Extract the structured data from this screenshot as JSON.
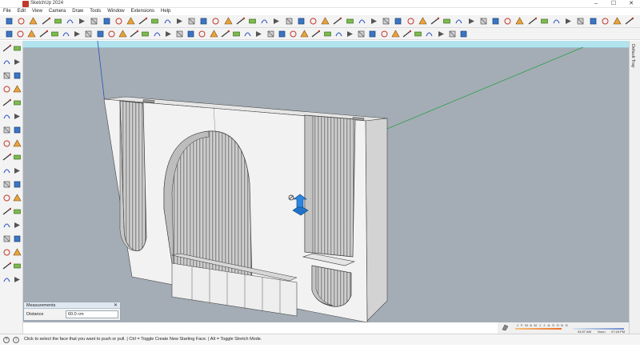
{
  "window": {
    "title": "SketchUp 2024",
    "controls": [
      "–",
      "☐",
      "✕"
    ]
  },
  "menu": [
    "File",
    "Edit",
    "View",
    "Camera",
    "Draw",
    "Tools",
    "Window",
    "Extensions",
    "Help"
  ],
  "colors": {
    "viewport_background": "#a4adb5",
    "sky": "#b3e3ee",
    "model_face": "#f2f2f2",
    "model_shadow_face": "#d6d6d6",
    "red_axis": "#c0392b",
    "green_axis": "#2e9e4a",
    "blue_axis": "#2b4fc0",
    "push_pull_cursor": "#1f73c9"
  },
  "toolbar_top_icons": [
    "orbit-icon",
    "pan-icon",
    "zoom-icon",
    "zoom-extents-icon",
    "iso-view-icon",
    "top-view-icon",
    "front-view-icon",
    "right-view-icon",
    "back-view-icon",
    "left-view-icon",
    "bottom-view-icon",
    "xray-icon",
    "wireframe-icon",
    "hidden-line-icon",
    "shaded-icon",
    "shaded-textures-icon",
    "monochrome-icon",
    "move-icon",
    "push-pull-icon",
    "rotate-icon",
    "follow-me-icon",
    "scale-icon",
    "offset-icon",
    "tape-measure-icon",
    "dimension-icon",
    "protractor-icon",
    "text-icon",
    "axes-icon",
    "3d-text-icon",
    "section-plane-icon",
    "search-icon",
    "select-icon",
    "paint-bucket-icon",
    "eraser-icon",
    "line-icon",
    "freehand-icon",
    "arc-icon",
    "circle-icon",
    "polygon-icon",
    "rectangle-icon",
    "move-tool-icon",
    "rotate-tool-icon",
    "scale-tool-icon",
    "flip-icon",
    "walk-icon",
    "look-around-icon",
    "position-camera-icon",
    "zoom-window-icon",
    "previous-view-icon",
    "next-view-icon",
    "warehouse-icon",
    "extension-icon"
  ],
  "toolbar_bottom_icons": [
    "sandbox-from-contours-icon",
    "sandbox-from-scratch-icon",
    "smoove-icon",
    "stamp-icon",
    "drape-icon",
    "add-detail-icon",
    "flip-edge-icon",
    "solid-outer-shell-icon",
    "solid-intersect-icon",
    "solid-union-icon",
    "solid-subtract-icon",
    "solid-trim-icon",
    "solid-split-icon",
    "curve-icon",
    "bezier-icon",
    "spline-icon",
    "round-corner-icon",
    "fillet-icon",
    "chamfer-icon",
    "extrude-icon",
    "loft-icon",
    "sweep-icon",
    "lattice-icon",
    "array-icon",
    "mirror-icon",
    "align-icon",
    "stack-icon",
    "pattern-icon",
    "fluted-panel-icon",
    "slats-icon",
    "grid-icon",
    "profile-icon",
    "shell-icon",
    "weld-icon",
    "smooth-icon",
    "subdivide-icon",
    "quadface-icon",
    "cleanup-icon",
    "solid-inspector-icon",
    "component-icon",
    "group-icon"
  ],
  "left_tools": [
    "select-icon",
    "lasso-icon",
    "paint-bucket-icon",
    "eraser-icon",
    "line-icon",
    "freehand-icon",
    "rectangle-icon",
    "rotated-rectangle-icon",
    "circle-icon",
    "polygon-icon",
    "arc-icon",
    "pie-icon",
    "move-icon",
    "push-pull-icon",
    "rotate-icon",
    "follow-me-icon",
    "scale-icon",
    "offset-icon",
    "tape-measure-icon",
    "dimension-icon",
    "protractor-icon",
    "text-icon",
    "axes-icon",
    "3d-text-icon",
    "orbit-icon",
    "pan-icon",
    "zoom-icon",
    "zoom-extents-icon",
    "walk-icon",
    "look-around-icon",
    "section-plane-icon",
    "display-section-icon",
    "position-camera-icon",
    "warehouse-icon",
    "extension-icon",
    "solid-icon"
  ],
  "tray": {
    "label": "Default Tray"
  },
  "measurements": {
    "title": "Measurements",
    "close": "✕",
    "label": "Distance",
    "value": "60.0 cm"
  },
  "shadow_timeline": {
    "months": [
      "J",
      "F",
      "M",
      "A",
      "M",
      "J",
      "J",
      "A",
      "S",
      "O",
      "N",
      "D"
    ],
    "time_start": "04:57 AM",
    "time_noon": "Noon",
    "time_end": "07:18 PM"
  },
  "status": {
    "message": "Click to select the face that you want to push or pull. | Ctrl = Toggle Create New Starting Face. | Alt = Toggle Stretch Mode."
  }
}
